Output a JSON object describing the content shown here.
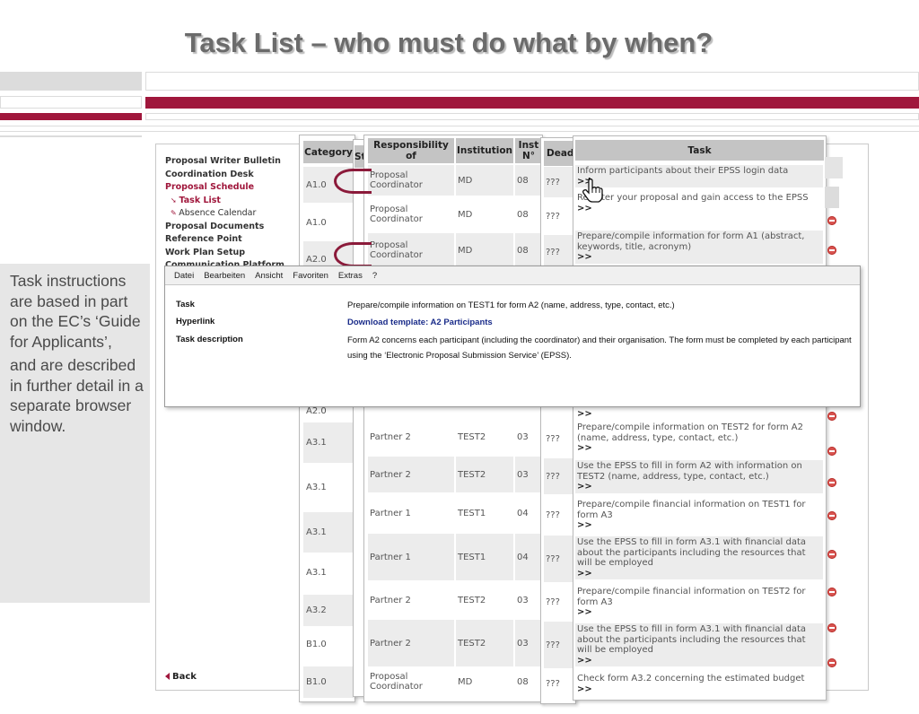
{
  "slide_title": "Task List – who must do what by when?",
  "colors": {
    "accent": "#a0173c",
    "header_gray": "#c4c4c4",
    "note_bg": "#e6e6e6"
  },
  "side_note": {
    "para1": "Task instructions are based in part on the EC’s ‘Guide for Applicants’,",
    "para2": "and are described in further detail in a separate browser window."
  },
  "nav": {
    "items": [
      {
        "label": "Proposal Writer Bulletin",
        "style": "b"
      },
      {
        "label": "Coordination Desk",
        "style": "b"
      },
      {
        "label": "Proposal Schedule",
        "style": "active"
      },
      {
        "label": "Task List",
        "style": "active-sub",
        "icon": "arrow-icon"
      },
      {
        "label": "Absence Calendar",
        "style": "sub",
        "icon": "pencil-icon"
      },
      {
        "label": "Proposal Documents",
        "style": "b"
      },
      {
        "label": "Reference Point",
        "style": "b"
      },
      {
        "label": "Work Plan Setup",
        "style": "b"
      },
      {
        "label": "Communication Platform",
        "style": "b"
      }
    ],
    "back_label": "Back"
  },
  "category_panel": {
    "header": "Category",
    "values": [
      "A1.0",
      "A1.0",
      "A2.0",
      "A2.0",
      "A3.1",
      "A3.1",
      "A3.1",
      "A3.1",
      "A3.2",
      "B1.0",
      "B1.0"
    ]
  },
  "status_header": "St",
  "responsibility_panel": {
    "headers": {
      "responsibility": "Responsibility of",
      "institution": "Institution",
      "inst_no": "Inst N°"
    },
    "rows": [
      {
        "resp": "Proposal Coordinator",
        "inst": "MD",
        "no": "08"
      },
      {
        "resp": "Proposal Coordinator",
        "inst": "MD",
        "no": "08"
      },
      {
        "resp": "Proposal Coordinator",
        "inst": "MD",
        "no": "08"
      },
      {
        "resp": "Partner 2",
        "inst": "TEST2",
        "no": "03"
      },
      {
        "resp": "Partner 2",
        "inst": "TEST2",
        "no": "03"
      },
      {
        "resp": "Partner 1",
        "inst": "TEST1",
        "no": "04"
      },
      {
        "resp": "Partner 1",
        "inst": "TEST1",
        "no": "04"
      },
      {
        "resp": "Partner 2",
        "inst": "TEST2",
        "no": "03"
      },
      {
        "resp": "Partner 2",
        "inst": "TEST2",
        "no": "03"
      },
      {
        "resp": "Proposal Coordinator",
        "inst": "MD",
        "no": "08"
      }
    ]
  },
  "deadline_panel": {
    "header": "Dead",
    "values": [
      "???",
      "???",
      "???",
      "???",
      "???",
      "???",
      "???",
      "???",
      "???",
      "???"
    ]
  },
  "task_panel": {
    "header": "Task",
    "more": ">>",
    "rows": [
      "Inform participants about their EPSS login data",
      "Register your proposal and gain access to the EPSS",
      "Prepare/compile information for form A1 (abstract, keywords, title, acronym)",
      "Prepare/compile information on TEST2 for form A2 (name, address, type, contact, etc.)",
      "Use the EPSS to fill in form A2 with information on TEST2 (name, address, type, contact, etc.)",
      "Prepare/compile financial information on TEST1 for form A3",
      "Use the EPSS to fill in form A3.1 with financial data about the participants including the resources that will be employed",
      "Prepare/compile financial information on TEST2 for form A3",
      "Use the EPSS to fill in form A3.1 with financial data about the participants including the resources that will be employed",
      "Check form A3.2 concerning the estimated budget"
    ]
  },
  "popup": {
    "menu": [
      "Datei",
      "Bearbeiten",
      "Ansicht",
      "Favoriten",
      "Extras",
      "?"
    ],
    "task_label": "Task",
    "task_value": "Prepare/compile information on TEST1 for form A2 (name, address, type, contact, etc.)",
    "hyperlink_label": "Hyperlink",
    "hyperlink_value": "Download template: A2 Participants",
    "desc_label": "Task description",
    "desc_value": "Form A2 concerns each participant (including the coordinator) and their organisation. The form must be completed by each participant using the ‘Electronic Proposal Submission Service’ (EPSS)."
  }
}
